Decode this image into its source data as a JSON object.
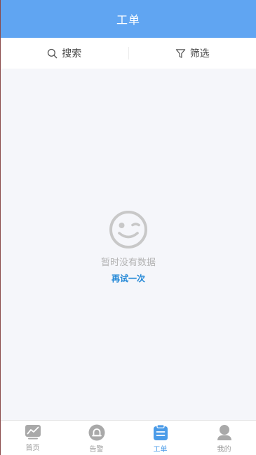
{
  "header": {
    "title": "工单"
  },
  "toolbar": {
    "search_label": "搜索",
    "filter_label": "筛选"
  },
  "empty_state": {
    "icon": "wink-face-icon",
    "message": "暂时没有数据",
    "retry_label": "再试一次"
  },
  "tabbar": {
    "items": [
      {
        "label": "首页",
        "icon": "chart-line-icon",
        "active": false
      },
      {
        "label": "告警",
        "icon": "bell-icon",
        "active": false
      },
      {
        "label": "工单",
        "icon": "clipboard-icon",
        "active": true
      },
      {
        "label": "我的",
        "icon": "user-icon",
        "active": false
      }
    ]
  },
  "colors": {
    "header_bg": "#60a5f2",
    "page_bg": "#f5f6fa",
    "retry_link": "#1f86d6",
    "active_tab": "#4a9be8",
    "inactive_icon": "#a9a9a9"
  }
}
